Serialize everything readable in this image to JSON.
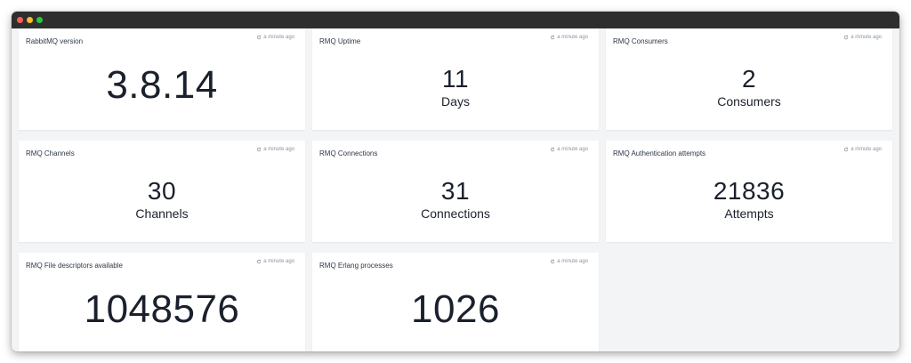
{
  "window": {
    "controls": [
      "close",
      "minimize",
      "maximize"
    ]
  },
  "panels": [
    {
      "title": "RabbitMQ version",
      "updated": "a minute ago",
      "value": "3.8.14",
      "unit": ""
    },
    {
      "title": "RMQ Uptime",
      "updated": "a minute ago",
      "value": "11",
      "unit": "Days"
    },
    {
      "title": "RMQ Consumers",
      "updated": "a minute ago",
      "value": "2",
      "unit": "Consumers"
    },
    {
      "title": "RMQ Channels",
      "updated": "a minute ago",
      "value": "30",
      "unit": "Channels"
    },
    {
      "title": "RMQ Connections",
      "updated": "a minute ago",
      "value": "31",
      "unit": "Connections"
    },
    {
      "title": "RMQ Authentication attempts",
      "updated": "a minute ago",
      "value": "21836",
      "unit": "Attempts"
    },
    {
      "title": "RMQ File descriptors available",
      "updated": "a minute ago",
      "value": "1048576",
      "unit": ""
    },
    {
      "title": "RMQ Erlang processes",
      "updated": "a minute ago",
      "value": "1026",
      "unit": ""
    }
  ],
  "colors": {
    "titlebar": "#2e2e2e",
    "background": "#f3f4f6",
    "panel": "#ffffff",
    "value_text": "#1a202c"
  },
  "icons": {
    "refresh": "refresh-icon"
  }
}
